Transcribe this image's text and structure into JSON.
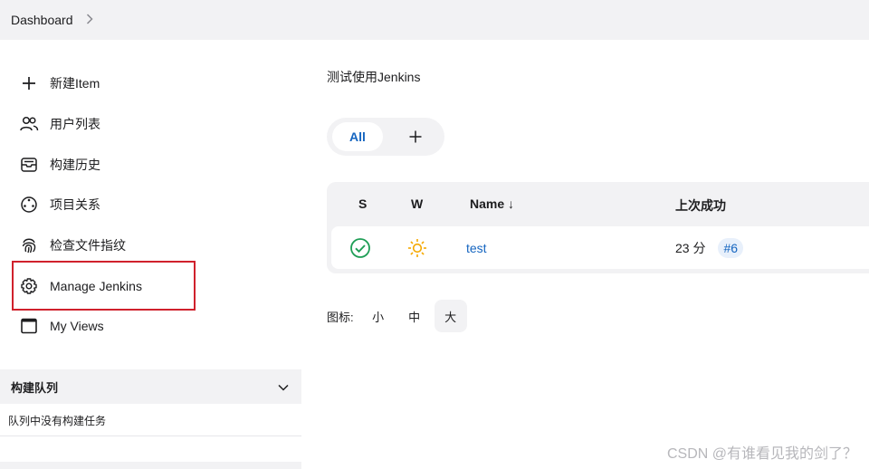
{
  "breadcrumb": {
    "dashboard": "Dashboard"
  },
  "sidebar": {
    "items": [
      {
        "label": "新建Item",
        "icon": "plus-icon"
      },
      {
        "label": "用户列表",
        "icon": "users-icon"
      },
      {
        "label": "构建历史",
        "icon": "inbox-icon"
      },
      {
        "label": "项目关系",
        "icon": "relations-icon"
      },
      {
        "label": "检查文件指纹",
        "icon": "fingerprint-icon"
      },
      {
        "label": "Manage Jenkins",
        "icon": "gear-icon"
      },
      {
        "label": "My Views",
        "icon": "window-icon"
      }
    ],
    "queue": {
      "title": "构建队列",
      "empty": "队列中没有构建任务"
    }
  },
  "main": {
    "description": "测试使用Jenkins",
    "tabs": {
      "all": "All"
    },
    "table": {
      "headers": {
        "status": "S",
        "weather": "W",
        "name": "Name ↓",
        "last_success": "上次成功"
      },
      "rows": [
        {
          "name": "test",
          "last_success": "23 分",
          "build": "#6"
        }
      ]
    },
    "icon_size": {
      "label": "图标:",
      "small": "小",
      "medium": "中",
      "large": "大",
      "selected": "大"
    }
  },
  "watermark": "CSDN @有谁看见我的剑了？",
  "colors": {
    "link": "#1565c0",
    "success": "#1f9e56",
    "sunny": "#f5a800",
    "highlight": "#d0212c"
  }
}
